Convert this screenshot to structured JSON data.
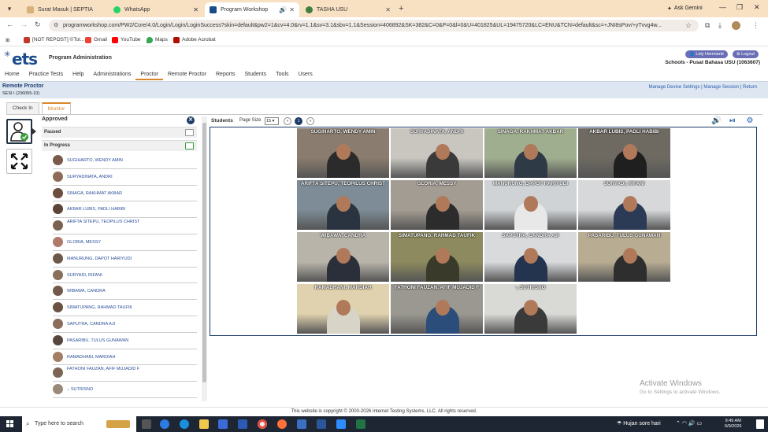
{
  "browser": {
    "tabs": [
      {
        "label": "Surat Masuk | SEPTIA",
        "color": "#d8b078"
      },
      {
        "label": "WhatsApp",
        "color": "#25d366"
      },
      {
        "label": "Program Workshop",
        "color": "#1a4b8c"
      },
      {
        "label": "TASHA USU",
        "color": "#3f7f3f"
      }
    ],
    "ask_gemini": "Ask Gemini",
    "url": "programworkshop.com/PW2/Core/4.0/Login/Login/LoginSuccess?skin=default&pw2=1&cv=4.0&rv=1.1&sv=3.1&sbv=1.1&Session=406892&SK=382&C=0&P=0&l=0&U=401825&UL=19475720&LC=ENU&TCN=default&sc=+JNI8sPov/+yTvvg4w...",
    "bookmarks": [
      {
        "label": "[NOT REPOST] ©Tol...",
        "color": "#c0392b"
      },
      {
        "label": "Gmail",
        "color": "#ea4335"
      },
      {
        "label": "YouTube",
        "color": "#ff0000"
      },
      {
        "label": "Maps",
        "color": "#34a853"
      },
      {
        "label": "Adobe Acrobat",
        "color": "#b30b00"
      }
    ]
  },
  "site": {
    "logo": "ets",
    "app_title": "Program Administration",
    "user": "Lely Hermianti",
    "logout": "Logout",
    "school": "Schools - Pusat Bahasa USU (1063607)",
    "nav": [
      "Home",
      "Practice Tests",
      "Help",
      "Administrations",
      "Proctor",
      "Remote Proctor",
      "Reports",
      "Students",
      "Tools",
      "Users"
    ],
    "nav_active": "Proctor"
  },
  "remote_proctor": {
    "title": "Remote Proctor",
    "session": "SESI I (236055-10)",
    "links": "Manage Device Settings | Manage Session | Return"
  },
  "subtabs": [
    "Check In",
    "Monitor"
  ],
  "subtab_active": "Monitor",
  "approved": {
    "title": "Approved",
    "paused_label": "Paused",
    "in_progress_label": "In Progress",
    "students": [
      "SUGIHARTO, WENDY AMIN",
      "SURYADINATA, ANDRI",
      "SINAGA, RAKHMAT AKBAR",
      "AKBAR LUBIS, PADLI HABIBI",
      "ARIFTA SITEPU, TEOPILUS CHRIST",
      "GLORIA, MESSY",
      "MANURUNG, DAPOT HARIYUDI",
      "SURYADI, RIFANI",
      "WIBAWA, CANDRA",
      "SIMATUPANG, RAHMAD TAUFIK",
      "SAPUTRA, CANDRA AJI",
      "PASARIBU, TULUS GUNAWAN",
      "RAMADHANI, MARDIAH",
      "FATHONI FAUZAN, AFIF MUJADID F",
      "-, SUTRISNO"
    ]
  },
  "students_panel": {
    "label": "Students",
    "page_size_label": "Page Size",
    "page_size": "15",
    "current_page": "1",
    "tiles": [
      {
        "name": "SUGIHARTO, WENDY AMIN",
        "wall": "#8a7c6e",
        "shirt": "#2b2b2b"
      },
      {
        "name": "SURYADINATA, ANDRI",
        "wall": "#c9c6c0",
        "shirt": "#3a3a3a"
      },
      {
        "name": "SINAGA, RAKHMAT AKBAR",
        "wall": "#9fae8e",
        "shirt": "#2e3a46"
      },
      {
        "name": "AKBAR LUBIS, PADLI HABIBI",
        "wall": "#6e6a62",
        "shirt": "#1f1f1f"
      },
      {
        "name": "ARIFTA SITEPU, TEOPILUS CHRIST",
        "wall": "#7d8c96",
        "shirt": "#2a3440"
      },
      {
        "name": "GLORIA, MESSY",
        "wall": "#a39c92",
        "shirt": "#2c2c2c"
      },
      {
        "name": "MANURUNG, DAPOT HARIYUDI",
        "wall": "#cfd3d6",
        "shirt": "#e8e8e8"
      },
      {
        "name": "SURYADI, RIFANI",
        "wall": "#d6d8da",
        "shirt": "#2b3a55"
      },
      {
        "name": "WIBAWA, CANDRA",
        "wall": "#b9b4aa",
        "shirt": "#2a2f3a"
      },
      {
        "name": "SIMATUPANG, RAHMAD TAUFIK",
        "wall": "#8c8a5e",
        "shirt": "#3a3a2a"
      },
      {
        "name": "SAPUTRA, CANDRA AJI",
        "wall": "#d8dadc",
        "shirt": "#24344f"
      },
      {
        "name": "PASARIBU, TULUS GUNAWAN",
        "wall": "#b8ad93",
        "shirt": "#2e2e2e"
      },
      {
        "name": "RAMADHANI, MARDIAH",
        "wall": "#e0d2ae",
        "shirt": "#d8d4c8"
      },
      {
        "name": "FATHONI FAUZAN, AFIF MUJADID F",
        "wall": "#9a9890",
        "shirt": "#2b4d7a"
      },
      {
        "name": "-, SUTRISNO",
        "wall": "#d9d9d6",
        "shirt": "#3a3a3a"
      }
    ]
  },
  "watermark": {
    "title": "Activate Windows",
    "subtitle": "Go to Settings to activate Windows."
  },
  "footer": {
    "copyright": "This website is copyright © 2000-2026 Internet Testing Systems, LLC. All rights reserved."
  },
  "taskbar": {
    "search_placeholder": "Type here to search",
    "weather": "Hujan sore hari",
    "time": "9:49 AM",
    "date": "6/9/2026"
  }
}
